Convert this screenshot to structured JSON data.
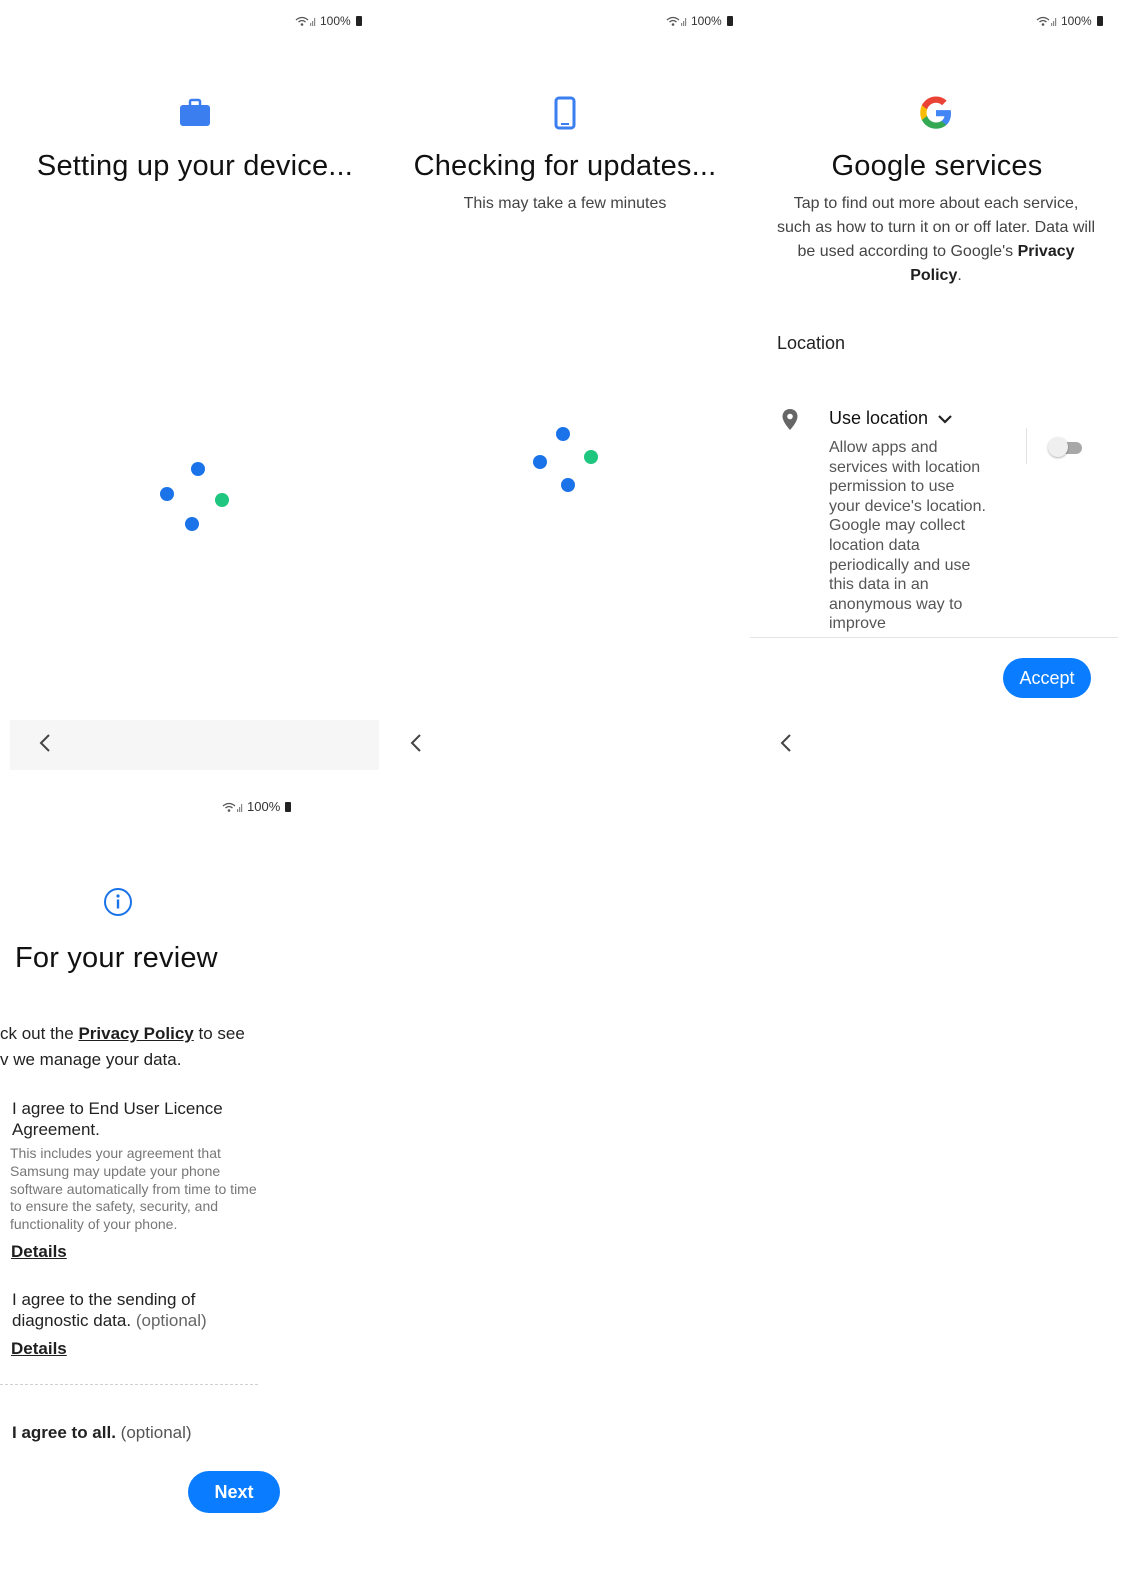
{
  "status": {
    "battery": "100%"
  },
  "panel1": {
    "title": "Setting up your device..."
  },
  "panel2": {
    "title": "Checking for updates...",
    "subtitle": "This may take a few minutes"
  },
  "panel3": {
    "title": "Google services",
    "description_prefix": "Tap to find out more about each service, such as how to turn it on or off later. Data will be used according to Google's ",
    "privacy_link": "Privacy Policy",
    "description_suffix": ".",
    "section_label": "Location",
    "use_location_label": "Use location",
    "use_location_desc": "Allow apps and services with location permission to use your device's location. Google may collect location data periodically and use this data in an anonymous way to improve",
    "use_location_enabled": false,
    "accept_label": "Accept"
  },
  "panel4": {
    "title": "For your review",
    "intro_prefix": "ck out the ",
    "intro_link": "Privacy Policy",
    "intro_suffix": " to see",
    "intro_line2": "v we manage your data.",
    "eula_label": "I agree to End User Licence Agreement.",
    "eula_desc": "This includes your agreement that Samsung may update your phone software automatically from time to time to ensure the safety, security, and functionality of your phone.",
    "details_1": "Details",
    "diag_label": "I agree to the sending of diagnostic data.",
    "diag_optional": "(optional)",
    "details_2": "Details",
    "all_label": "I agree to all.",
    "all_optional": "(optional)",
    "next_label": "Next"
  },
  "colors": {
    "accent": "#0a7cff",
    "dot_blue": "#1a73e8",
    "dot_green": "#1fc67f"
  }
}
